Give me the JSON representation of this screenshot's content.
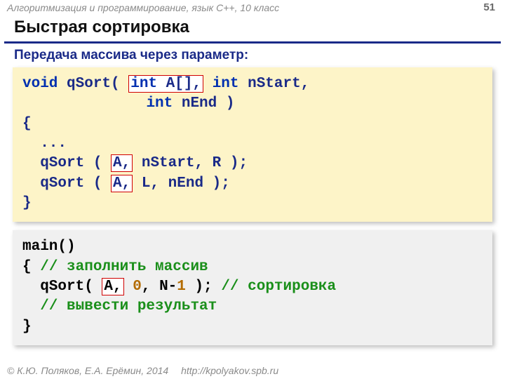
{
  "header": {
    "course": "Алгоритмизация и программирование, язык C++, 10 класс",
    "page": "51"
  },
  "title": "Быстрая сортировка",
  "subhead": "Передача массива через параметр:",
  "code1": {
    "l1a": "void",
    "l1b": " qSort( ",
    "hl1_kw": "int",
    "hl1_rest": " A[],",
    "l1c": " ",
    "l1d": "int",
    "l1e": " nStart,",
    "l2a": "              ",
    "l2b": "int",
    "l2c": " nEnd )",
    "l3": "{",
    "l4": "  ...",
    "l5a": "  qSort ( ",
    "hl2": "A,",
    "l5b": " nStart, R );",
    "l6a": "  qSort ( ",
    "hl3": "A,",
    "l6b": " L, nEnd );",
    "l7": "}"
  },
  "code2": {
    "l1": "main()",
    "l2a": "{ ",
    "l2b": "// заполнить массив",
    "l3a": "  qSort( ",
    "hl4": "A,",
    "l3b": " ",
    "l3c": "0",
    "l3d": ", N-",
    "l3e": "1",
    "l3f": " ); ",
    "l3g": "// сортировка",
    "l4": "  // вывести результат",
    "l5": "}"
  },
  "footer": {
    "copyright": "© К.Ю. Поляков, Е.А. Ерёмин, 2014",
    "url": "http://kpolyakov.spb.ru"
  }
}
